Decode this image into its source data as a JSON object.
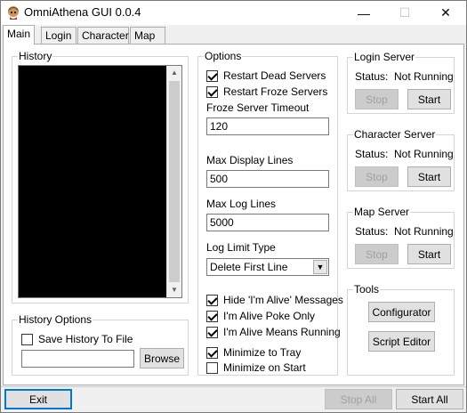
{
  "window": {
    "title": "OmniAthena GUI 0.0.4",
    "icon": "app-icon",
    "controls": {
      "minimize": "—",
      "maximize": "☐",
      "close": "✕"
    }
  },
  "tabs": [
    {
      "label": "Main",
      "active": true
    },
    {
      "label": "Login",
      "active": false
    },
    {
      "label": "Character",
      "active": false
    },
    {
      "label": "Map",
      "active": false
    }
  ],
  "history": {
    "title": "History",
    "scroll_up": "▲",
    "scroll_down": "▼"
  },
  "history_options": {
    "title": "History Options",
    "save_to_file": {
      "label": "Save History To File",
      "checked": false
    },
    "path_value": "",
    "browse_label": "Browse"
  },
  "options": {
    "title": "Options",
    "restart_dead": {
      "label": "Restart Dead Servers",
      "checked": true
    },
    "restart_froze": {
      "label": "Restart Froze Servers",
      "checked": true
    },
    "froze_timeout": {
      "label": "Froze Server Timeout",
      "value": "120"
    },
    "max_display": {
      "label": "Max Display Lines",
      "value": "500"
    },
    "max_log": {
      "label": "Max Log Lines",
      "value": "5000"
    },
    "log_limit": {
      "label": "Log Limit Type",
      "value": "Delete First Line",
      "arrow": "▼"
    },
    "hide_alive": {
      "label": "Hide 'I'm Alive' Messages",
      "checked": true
    },
    "alive_poke": {
      "label": "I'm Alive Poke Only",
      "checked": true
    },
    "alive_running": {
      "label": "I'm Alive Means Running",
      "checked": true
    },
    "min_tray": {
      "label": "Minimize to Tray",
      "checked": true
    },
    "min_start": {
      "label": "Minimize on Start",
      "checked": false
    }
  },
  "servers": [
    {
      "title": "Login Server",
      "status_label": "Status:",
      "status_value": "Not Running",
      "stop": "Stop",
      "start": "Start"
    },
    {
      "title": "Character Server",
      "status_label": "Status:",
      "status_value": "Not Running",
      "stop": "Stop",
      "start": "Start"
    },
    {
      "title": "Map Server",
      "status_label": "Status:",
      "status_value": "Not Running",
      "stop": "Stop",
      "start": "Start"
    }
  ],
  "tools": {
    "title": "Tools",
    "configurator": "Configurator",
    "script_editor": "Script Editor"
  },
  "footer": {
    "exit": "Exit",
    "stop_all": "Stop All",
    "start_all": "Start All"
  }
}
